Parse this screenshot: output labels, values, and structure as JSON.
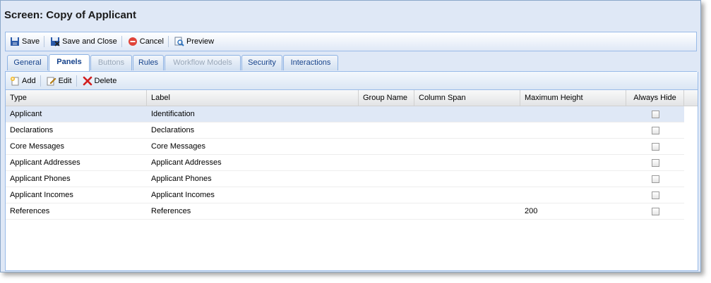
{
  "window": {
    "title": "Screen: Copy of Applicant"
  },
  "toolbar": {
    "save_label": "Save",
    "save_close_label": "Save and Close",
    "cancel_label": "Cancel",
    "preview_label": "Preview"
  },
  "tabs": [
    {
      "label": "General",
      "state": "normal"
    },
    {
      "label": "Panels",
      "state": "active"
    },
    {
      "label": "Buttons",
      "state": "disabled"
    },
    {
      "label": "Rules",
      "state": "normal"
    },
    {
      "label": "Workflow Models",
      "state": "disabled"
    },
    {
      "label": "Security",
      "state": "normal"
    },
    {
      "label": "Interactions",
      "state": "normal"
    }
  ],
  "panel_toolbar": {
    "add_label": "Add",
    "edit_label": "Edit",
    "delete_label": "Delete"
  },
  "grid": {
    "columns": [
      "Type",
      "Label",
      "Group Name",
      "Column Span",
      "Maximum Height",
      "Always Hide"
    ],
    "rows": [
      {
        "type": "Applicant",
        "label": "Identification",
        "group": "",
        "span": "",
        "max_height": "",
        "always_hide": false,
        "selected": true
      },
      {
        "type": "Declarations",
        "label": "Declarations",
        "group": "",
        "span": "",
        "max_height": "",
        "always_hide": false
      },
      {
        "type": "Core Messages",
        "label": "Core Messages",
        "group": "",
        "span": "",
        "max_height": "",
        "always_hide": false
      },
      {
        "type": "Applicant Addresses",
        "label": "Applicant Addresses",
        "group": "",
        "span": "",
        "max_height": "",
        "always_hide": false
      },
      {
        "type": "Applicant Phones",
        "label": "Applicant Phones",
        "group": "",
        "span": "",
        "max_height": "",
        "always_hide": false
      },
      {
        "type": "Applicant Incomes",
        "label": "Applicant Incomes",
        "group": "",
        "span": "",
        "max_height": "",
        "always_hide": false
      },
      {
        "type": "References",
        "label": "References",
        "group": "",
        "span": "",
        "max_height": "200",
        "always_hide": false
      }
    ]
  }
}
